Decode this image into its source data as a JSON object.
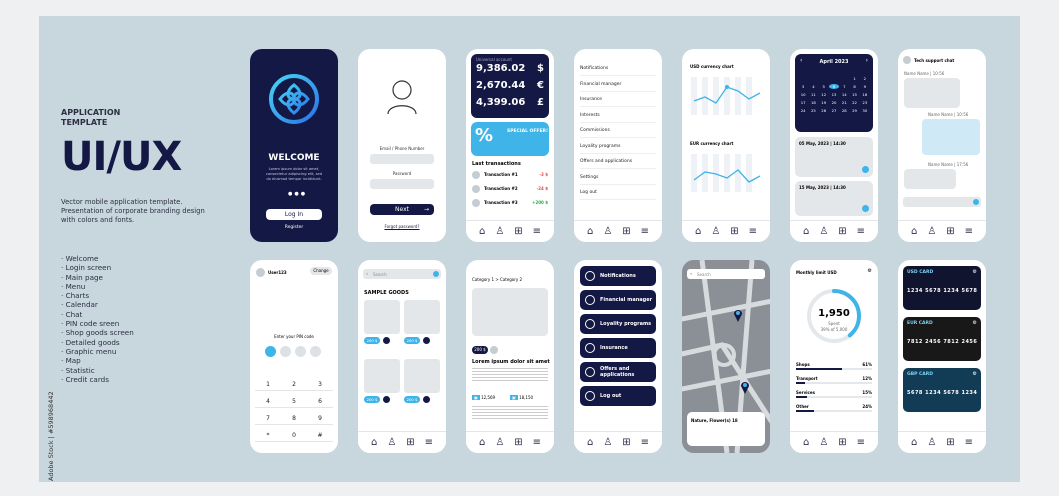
{
  "left": {
    "heading": "APPLICATION TEMPLATE",
    "big_title": "UI/UX",
    "desc": "Vector mobile application template. Presentation of corporate branding design with colors and fonts.",
    "list": [
      "· Welcome",
      "· Login screen",
      "· Main page",
      "· Menu",
      "· Charts",
      "· Calendar",
      "· Chat",
      "· PIN code sreen",
      "· Shop goods screen",
      "· Detailed goods",
      "· Graphic menu",
      "· Map",
      "· Statistic",
      "· Credit cards"
    ]
  },
  "stock_id": "Adobe Stock | #598968442",
  "welcome": {
    "title": "WELCOME",
    "text": "Lorem ipsum dolor sit amet, consectetur adipiscing elit, sed do eiusmod tempor incididunt.",
    "login": "Log In",
    "register": "Register"
  },
  "login": {
    "email_label": "Email / Phone Number",
    "password_label": "Password",
    "next": "Next",
    "forgot": "Forgot password?"
  },
  "main": {
    "acct": "Universal account",
    "amounts": [
      "9,386.02",
      "2,670.44",
      "4,399.06"
    ],
    "currencies": [
      "$",
      "€",
      "£"
    ],
    "offer": "SPECIAL OFFER!",
    "last_tx": "Last transactions",
    "tx": [
      {
        "name": "Transaction #1",
        "amt": "-3 $",
        "c": "#e04b4b"
      },
      {
        "name": "Transaction #2",
        "amt": "-24 $",
        "c": "#e04b4b"
      },
      {
        "name": "Transaction #3",
        "amt": "+200 $",
        "c": "#2ca84a"
      }
    ]
  },
  "menu": {
    "items": [
      "Notifications",
      "Financial manager",
      "Insurance",
      "Interests",
      "Commissions",
      "Loyality programs",
      "Offers and applications",
      "Settings",
      "Log out"
    ]
  },
  "charts": {
    "usd": "USD currency chart",
    "eur": "EUR currency chart"
  },
  "calendar": {
    "month": "April 2023",
    "days": [
      "1",
      "2",
      "3",
      "4",
      "5",
      "6",
      "7",
      "8",
      "9",
      "10",
      "11",
      "12",
      "13",
      "14",
      "15",
      "16",
      "17",
      "18",
      "19",
      "20",
      "21",
      "22",
      "23",
      "24",
      "25",
      "26",
      "27",
      "28",
      "29",
      "30"
    ],
    "events": [
      "05 May, 2023 | 14:30",
      "15 May, 2023 | 14:30"
    ]
  },
  "chat": {
    "title": "Tech support chat",
    "n1": "Name Name | 10:56",
    "n2": "Name Name | 10:56",
    "n3": "Name Name | 17:56"
  },
  "pin": {
    "user": "User123",
    "change": "Change",
    "label": "Enter your PIN code",
    "keys": [
      "1",
      "2",
      "3",
      "4",
      "5",
      "6",
      "7",
      "8",
      "9",
      "*",
      "0",
      "#"
    ]
  },
  "shop": {
    "search": "Search",
    "title": "SAMPLE GOODS",
    "price": "200 $"
  },
  "detail": {
    "breadcrumb": "Category 1 > Category 2",
    "price": "200 $",
    "title": "Lorem ipsum dolor sit amet",
    "stats": [
      "12,569",
      "18,150"
    ]
  },
  "gmenu": {
    "items": [
      "Notifications",
      "Financial manager",
      "Loyality programs",
      "Insurance",
      "Offers and applications",
      "Log out"
    ]
  },
  "map": {
    "search": "Search",
    "place": "Nature, Flower(s) 18"
  },
  "stat": {
    "title": "Monthly limit USD",
    "value": "1,950",
    "sub": "Spent",
    "pct": "39% of 5,000",
    "rows": [
      {
        "l": "Shops",
        "v": "61%",
        "w": 61
      },
      {
        "l": "Transport",
        "v": "12%",
        "w": 12
      },
      {
        "l": "Services",
        "v": "15%",
        "w": 15
      },
      {
        "l": "Other",
        "v": "24%",
        "w": 24
      }
    ]
  },
  "cards": {
    "items": [
      {
        "t": "USD CARD",
        "n": "1234 5678 1234 5678",
        "c": "#11142f"
      },
      {
        "t": "EUR CARD",
        "n": "7812 2456 7812 2456",
        "c": "#181818"
      },
      {
        "t": "GBP CARD",
        "n": "5678 1234 5678 1234",
        "c": "#123c55"
      }
    ]
  }
}
